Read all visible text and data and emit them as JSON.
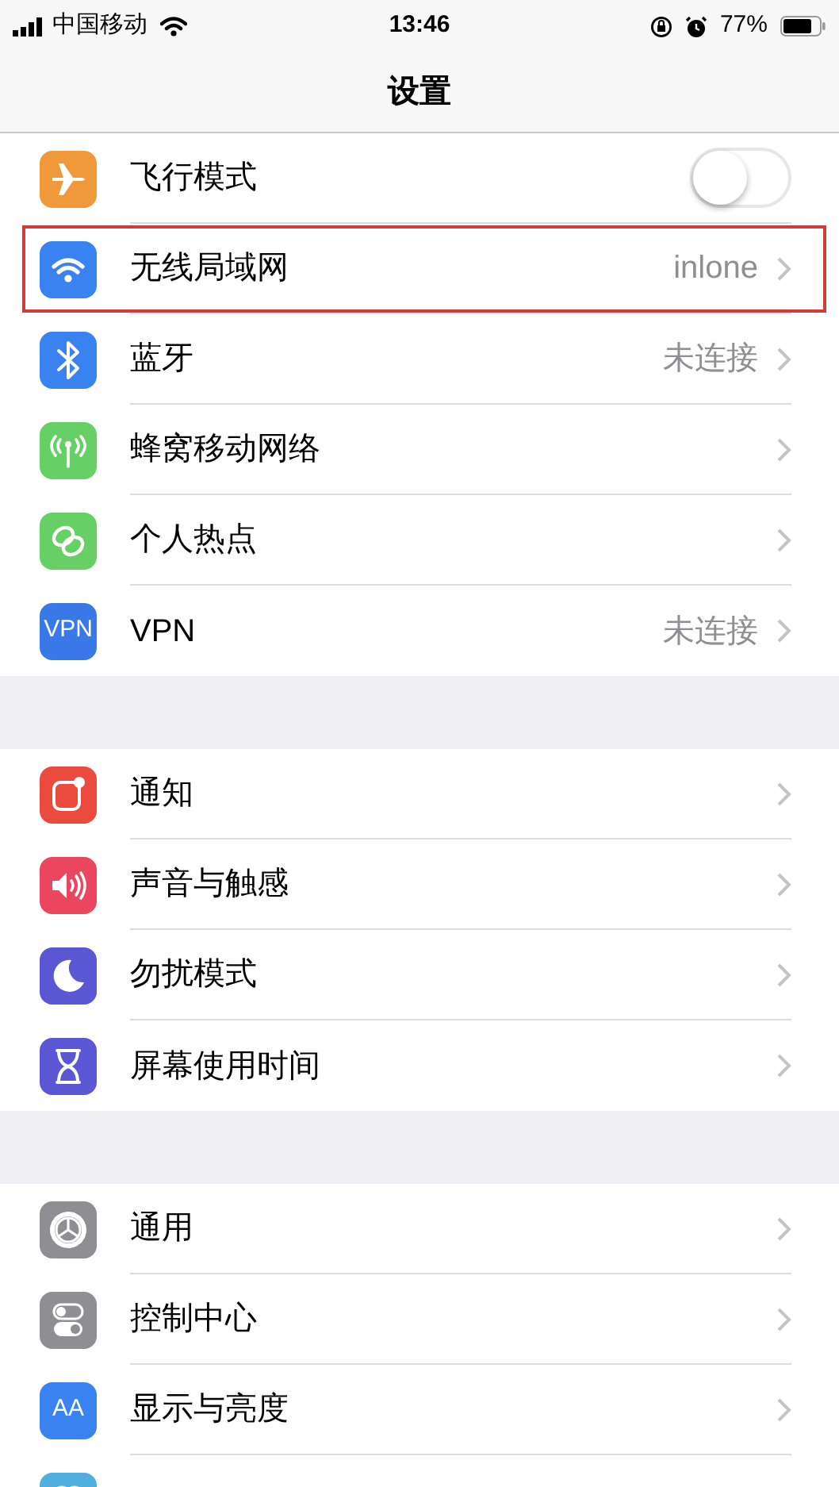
{
  "status_bar": {
    "carrier": "中国移动",
    "time": "13:46",
    "battery": "77%"
  },
  "title": "设置",
  "groups": [
    {
      "rows": [
        {
          "kind": "toggle",
          "label": "飞行模式",
          "color": "#f0993a",
          "on": false,
          "highlighted": false
        },
        {
          "kind": "link",
          "label": "无线局域网",
          "color": "#3a82f0",
          "value": "inlone",
          "highlighted": true
        },
        {
          "kind": "link",
          "label": "蓝牙",
          "color": "#3a82f0",
          "value": "未连接",
          "highlighted": false
        },
        {
          "kind": "link",
          "label": "蜂窝移动网络",
          "color": "#66cf66",
          "highlighted": false
        },
        {
          "kind": "link",
          "label": "个人热点",
          "color": "#66cf66",
          "highlighted": false
        },
        {
          "kind": "link",
          "label": "VPN",
          "color": "#3a78e8",
          "icon_text": "VPN",
          "value": "未连接",
          "highlighted": false
        }
      ]
    },
    {
      "rows": [
        {
          "kind": "link",
          "label": "通知",
          "color": "#eb4b3f",
          "highlighted": false
        },
        {
          "kind": "link",
          "label": "声音与触感",
          "color": "#eb4560",
          "highlighted": false
        },
        {
          "kind": "link",
          "label": "勿扰模式",
          "color": "#5b56d4",
          "highlighted": false
        },
        {
          "kind": "link",
          "label": "屏幕使用时间",
          "color": "#5b56d4",
          "highlighted": false
        }
      ]
    },
    {
      "rows": [
        {
          "kind": "link",
          "label": "通用",
          "color": "#8e8e93",
          "highlighted": false
        },
        {
          "kind": "link",
          "label": "控制中心",
          "color": "#8e8e93",
          "highlighted": false
        },
        {
          "kind": "link",
          "label": "显示与亮度",
          "color": "#3a82f0",
          "icon_text": "AA",
          "highlighted": false
        },
        {
          "kind": "partial",
          "color": "#4fb0e0",
          "highlighted": false
        }
      ]
    }
  ]
}
